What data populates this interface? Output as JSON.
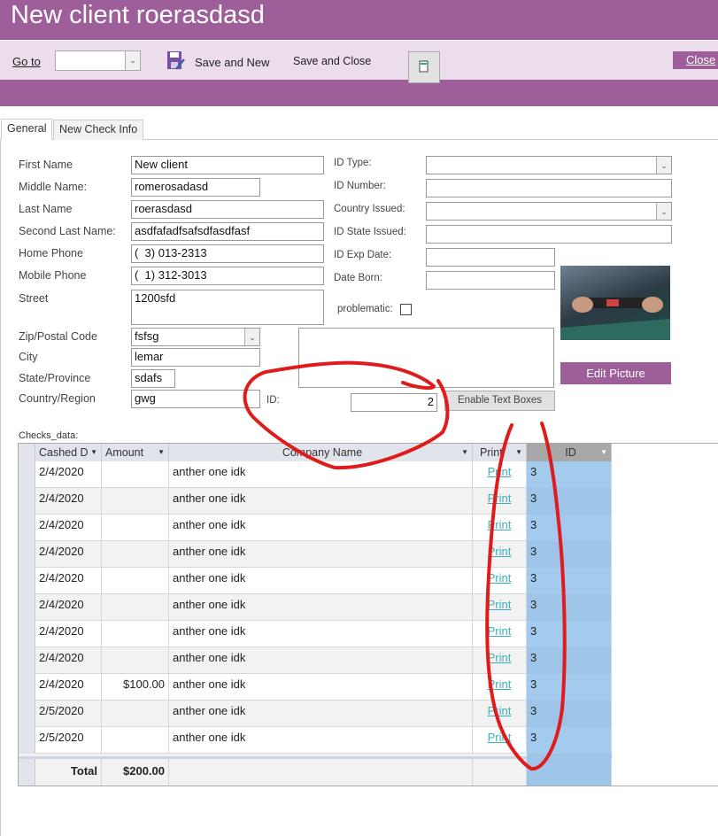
{
  "title": "New client roerasdasd",
  "toolbar": {
    "goto_label": "Go to",
    "goto_value": "",
    "save_new": "Save and New",
    "save_close": "Save and Close",
    "close": "Close"
  },
  "tabs": [
    {
      "label": "General"
    },
    {
      "label": "New Check Info"
    }
  ],
  "form": {
    "first_name": {
      "label": "First Name",
      "value": "New client"
    },
    "middle_name": {
      "label": "Middle Name:",
      "value": "romerosadasd"
    },
    "last_name": {
      "label": "Last Name",
      "value": "roerasdasd"
    },
    "second_last_name": {
      "label": "Second Last Name:",
      "value": "asdfafadfsafsdfasdfasf"
    },
    "home_phone": {
      "label": "Home Phone",
      "value": "(  3) 013-2313"
    },
    "mobile_phone": {
      "label": "Mobile Phone",
      "value": "(  1) 312-3013"
    },
    "street": {
      "label": "Street",
      "value": "1200sfd"
    },
    "zip": {
      "label": "Zip/Postal Code",
      "value": "fsfsg"
    },
    "city": {
      "label": "City",
      "value": "lemar"
    },
    "state": {
      "label": "State/Province",
      "value": "sdafs"
    },
    "country": {
      "label": "Country/Region",
      "value": "gwg"
    },
    "id_type": {
      "label": "ID Type:",
      "value": ""
    },
    "id_number": {
      "label": "ID Number:",
      "value": ""
    },
    "country_issued": {
      "label": "Country Issued:",
      "value": ""
    },
    "id_state": {
      "label": "ID State Issued:",
      "value": ""
    },
    "id_exp": {
      "label": "ID Exp Date:",
      "value": ""
    },
    "date_born": {
      "label": "Date Born:",
      "value": ""
    },
    "problematic": {
      "label": "problematic:",
      "checked": false
    },
    "id": {
      "label": "ID:",
      "value": "2"
    },
    "edit_picture": "Edit Picture",
    "enable_text_boxes": "Enable Text Boxes"
  },
  "grid": {
    "label": "Checks_data:",
    "columns": [
      "Cashed D",
      "Amount",
      "Company Name",
      "Print",
      "ID"
    ],
    "rows": [
      {
        "date": "2/4/2020",
        "amount": "",
        "company": "anther one idk",
        "print": "Print",
        "id": "3"
      },
      {
        "date": "2/4/2020",
        "amount": "",
        "company": "anther one idk",
        "print": "Print",
        "id": "3"
      },
      {
        "date": "2/4/2020",
        "amount": "",
        "company": "anther one idk",
        "print": "Print",
        "id": "3"
      },
      {
        "date": "2/4/2020",
        "amount": "",
        "company": "anther one idk",
        "print": "Print",
        "id": "3"
      },
      {
        "date": "2/4/2020",
        "amount": "",
        "company": "anther one idk",
        "print": "Print",
        "id": "3"
      },
      {
        "date": "2/4/2020",
        "amount": "",
        "company": "anther one idk",
        "print": "Print",
        "id": "3"
      },
      {
        "date": "2/4/2020",
        "amount": "",
        "company": "anther one idk",
        "print": "Print",
        "id": "3"
      },
      {
        "date": "2/4/2020",
        "amount": "",
        "company": "anther one idk",
        "print": "Print",
        "id": "3"
      },
      {
        "date": "2/4/2020",
        "amount": "$100.00",
        "company": "anther one idk",
        "print": "Print",
        "id": "3"
      },
      {
        "date": "2/5/2020",
        "amount": "",
        "company": "anther one idk",
        "print": "Print",
        "id": "3"
      },
      {
        "date": "2/5/2020",
        "amount": "",
        "company": "anther one idk",
        "print": "Print",
        "id": "3"
      }
    ],
    "total_label": "Total",
    "total_amount": "$200.00"
  },
  "colors": {
    "brand": "#9E5E9A",
    "toolbar": "#EBDDEB",
    "id_column": "#A3CBEE",
    "annotation": "#E01B1B"
  }
}
